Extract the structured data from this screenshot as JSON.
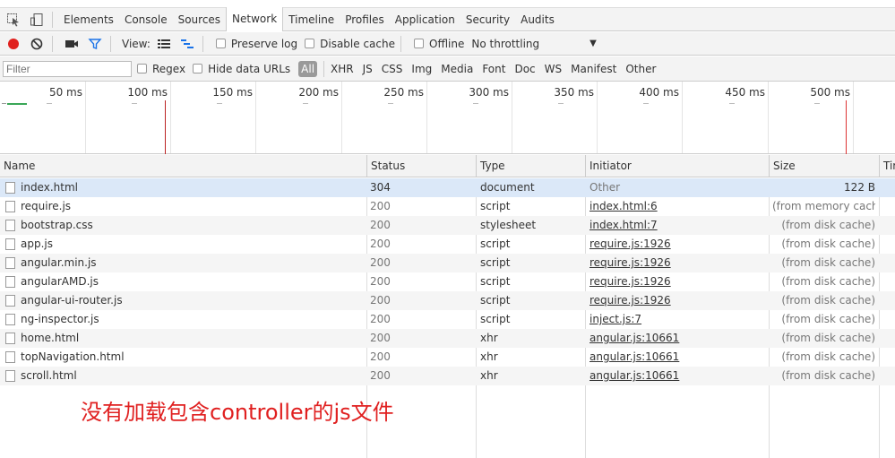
{
  "tabs": [
    {
      "label": "Elements"
    },
    {
      "label": "Console"
    },
    {
      "label": "Sources"
    },
    {
      "label": "Network",
      "active": true
    },
    {
      "label": "Timeline"
    },
    {
      "label": "Profiles"
    },
    {
      "label": "Application"
    },
    {
      "label": "Security"
    },
    {
      "label": "Audits"
    }
  ],
  "toolbar": {
    "view_label": "View:",
    "preserve_log": "Preserve log",
    "disable_cache": "Disable cache",
    "offline": "Offline",
    "throttling": "No throttling",
    "record_color": "#e0201d"
  },
  "filter": {
    "placeholder": "Filter",
    "regex": "Regex",
    "hide_data_urls": "Hide data URLs",
    "types": [
      "All",
      "XHR",
      "JS",
      "CSS",
      "Img",
      "Media",
      "Font",
      "Doc",
      "WS",
      "Manifest",
      "Other"
    ]
  },
  "overview": {
    "ticks": [
      "50 ms",
      "100 ms",
      "150 ms",
      "200 ms",
      "250 ms",
      "300 ms",
      "350 ms",
      "400 ms",
      "450 ms",
      "500 ms"
    ]
  },
  "table": {
    "headers": [
      "Name",
      "Status",
      "Type",
      "Initiator",
      "Size",
      "Tir"
    ],
    "rows": [
      {
        "name": "index.html",
        "status": "304",
        "type": "document",
        "initiator": "Other",
        "size": "122 B"
      },
      {
        "name": "require.js",
        "status": "200",
        "type": "script",
        "initiator": "index.html:6",
        "size": "(from memory cache)"
      },
      {
        "name": "bootstrap.css",
        "status": "200",
        "type": "stylesheet",
        "initiator": "index.html:7",
        "size": "(from disk cache)"
      },
      {
        "name": "app.js",
        "status": "200",
        "type": "script",
        "initiator": "require.js:1926",
        "size": "(from disk cache)"
      },
      {
        "name": "angular.min.js",
        "status": "200",
        "type": "script",
        "initiator": "require.js:1926",
        "size": "(from disk cache)"
      },
      {
        "name": "angularAMD.js",
        "status": "200",
        "type": "script",
        "initiator": "require.js:1926",
        "size": "(from disk cache)"
      },
      {
        "name": "angular-ui-router.js",
        "status": "200",
        "type": "script",
        "initiator": "require.js:1926",
        "size": "(from disk cache)"
      },
      {
        "name": "ng-inspector.js",
        "status": "200",
        "type": "script",
        "initiator": "inject.js:7",
        "size": "(from disk cache)"
      },
      {
        "name": "home.html",
        "status": "200",
        "type": "xhr",
        "initiator": "angular.js:10661",
        "size": "(from disk cache)"
      },
      {
        "name": "topNavigation.html",
        "status": "200",
        "type": "xhr",
        "initiator": "angular.js:10661",
        "size": "(from disk cache)"
      },
      {
        "name": "scroll.html",
        "status": "200",
        "type": "xhr",
        "initiator": "angular.js:10661",
        "size": "(from disk cache)"
      }
    ]
  },
  "annotation": "没有加载包含controller的js文件"
}
